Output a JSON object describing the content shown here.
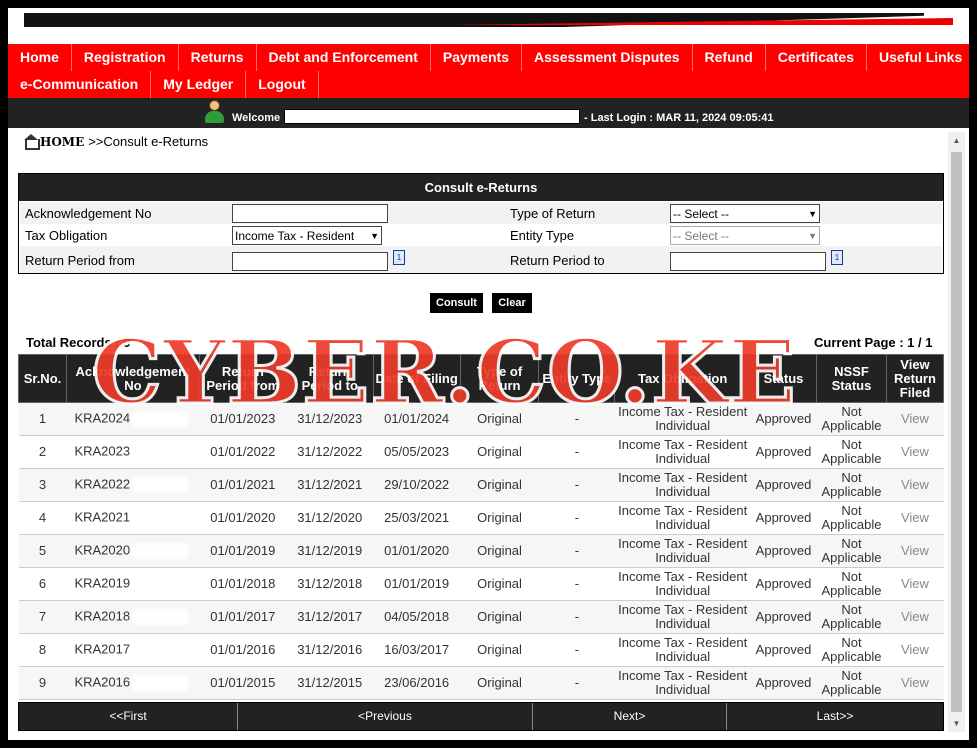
{
  "nav": {
    "row1": [
      "Home",
      "Registration",
      "Returns",
      "Debt and Enforcement",
      "Payments",
      "Assessment Disputes",
      "Refund",
      "Certificates",
      "Useful Links"
    ],
    "row2": [
      "e-Communication",
      "My Ledger",
      "Logout"
    ]
  },
  "header": {
    "welcome": "Welcome",
    "last_login": "- Last Login : MAR 11, 2024 09:05:41"
  },
  "breadcrumb": {
    "home": "HOME",
    "current": ">>Consult e-Returns"
  },
  "form": {
    "title": "Consult e-Returns",
    "ack_label": "Acknowledgement No",
    "ack_value": "",
    "type_label": "Type of Return",
    "type_value": "-- Select --",
    "tax_label": "Tax Obligation",
    "tax_value": "Income Tax - Resident",
    "entity_label": "Entity Type",
    "entity_value": "-- Select --",
    "from_label": "Return Period from",
    "from_value": "",
    "to_label": "Return Period to",
    "to_value": ""
  },
  "buttons": {
    "consult": "Consult",
    "clear": "Clear"
  },
  "summary": {
    "total": "Total Records : 9",
    "page": "Current Page : 1 / 1"
  },
  "table": {
    "headers": [
      "Sr.No.",
      "Acknowledgement No",
      "Return Period from",
      "Return Period to",
      "Date of Filing",
      "Type of Return",
      "Entity Type",
      "Tax Obligation",
      "Status",
      "NSSF Status",
      "View Return Filed"
    ],
    "rows": [
      {
        "sr": "1",
        "ack": "KRA2024",
        "from": "01/01/2023",
        "to": "31/12/2023",
        "filed": "01/01/2024",
        "type": "Original",
        "entity": "-",
        "obligation": "Income Tax - Resident Individual",
        "status": "Approved",
        "nssf": "Not Applicable",
        "view": "View"
      },
      {
        "sr": "2",
        "ack": "KRA2023",
        "from": "01/01/2022",
        "to": "31/12/2022",
        "filed": "05/05/2023",
        "type": "Original",
        "entity": "-",
        "obligation": "Income Tax - Resident Individual",
        "status": "Approved",
        "nssf": "Not Applicable",
        "view": "View"
      },
      {
        "sr": "3",
        "ack": "KRA2022",
        "from": "01/01/2021",
        "to": "31/12/2021",
        "filed": "29/10/2022",
        "type": "Original",
        "entity": "-",
        "obligation": "Income Tax - Resident Individual",
        "status": "Approved",
        "nssf": "Not Applicable",
        "view": "View"
      },
      {
        "sr": "4",
        "ack": "KRA2021",
        "from": "01/01/2020",
        "to": "31/12/2020",
        "filed": "25/03/2021",
        "type": "Original",
        "entity": "-",
        "obligation": "Income Tax - Resident Individual",
        "status": "Approved",
        "nssf": "Not Applicable",
        "view": "View"
      },
      {
        "sr": "5",
        "ack": "KRA2020",
        "from": "01/01/2019",
        "to": "31/12/2019",
        "filed": "01/01/2020",
        "type": "Original",
        "entity": "-",
        "obligation": "Income Tax - Resident Individual",
        "status": "Approved",
        "nssf": "Not Applicable",
        "view": "View"
      },
      {
        "sr": "6",
        "ack": "KRA2019",
        "from": "01/01/2018",
        "to": "31/12/2018",
        "filed": "01/01/2019",
        "type": "Original",
        "entity": "-",
        "obligation": "Income Tax - Resident Individual",
        "status": "Approved",
        "nssf": "Not Applicable",
        "view": "View"
      },
      {
        "sr": "7",
        "ack": "KRA2018",
        "from": "01/01/2017",
        "to": "31/12/2017",
        "filed": "04/05/2018",
        "type": "Original",
        "entity": "-",
        "obligation": "Income Tax - Resident Individual",
        "status": "Approved",
        "nssf": "Not Applicable",
        "view": "View"
      },
      {
        "sr": "8",
        "ack": "KRA2017",
        "from": "01/01/2016",
        "to": "31/12/2016",
        "filed": "16/03/2017",
        "type": "Original",
        "entity": "-",
        "obligation": "Income Tax - Resident Individual",
        "status": "Approved",
        "nssf": "Not Applicable",
        "view": "View"
      },
      {
        "sr": "9",
        "ack": "KRA2016",
        "from": "01/01/2015",
        "to": "31/12/2015",
        "filed": "23/06/2016",
        "type": "Original",
        "entity": "-",
        "obligation": "Income Tax - Resident Individual",
        "status": "Approved",
        "nssf": "Not Applicable",
        "view": "View"
      }
    ]
  },
  "pager": {
    "first": "<<First",
    "previous": "<Previous",
    "next": "Next>",
    "last": "Last>>"
  },
  "watermark": "CYBER.CO.KE",
  "icons": {
    "home": "home-icon",
    "user": "user-avatar-icon",
    "calendar": "calendar-icon"
  },
  "colors": {
    "nav_bg": "#ff0000",
    "dark_bar": "#222222",
    "watermark": "#ee3a2a"
  }
}
